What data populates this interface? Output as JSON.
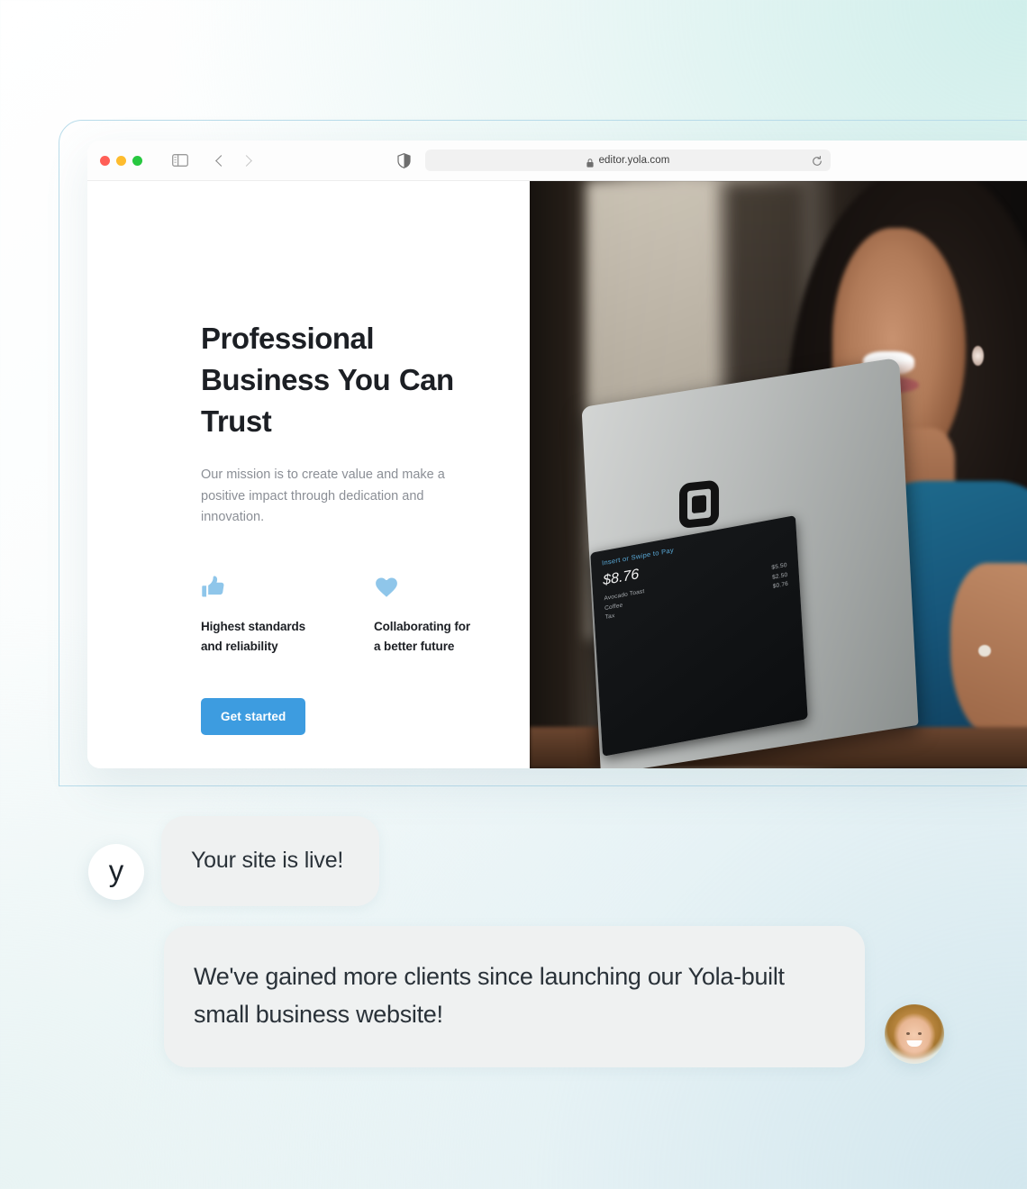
{
  "browser": {
    "url": "editor.yola.com",
    "icons": {
      "sidebar": "sidebar-toggle-icon",
      "back": "back-chevron-icon",
      "forward": "forward-chevron-icon",
      "shield": "privacy-shield-icon",
      "lock": "lock-icon",
      "reload": "reload-icon"
    }
  },
  "hero": {
    "title": "Professional Business You Can Trust",
    "subtitle": "Our mission is to create value and make a positive impact through dedication and innovation.",
    "features": [
      {
        "icon": "thumbs-up-icon",
        "label": "Highest standards and reliability"
      },
      {
        "icon": "heart-icon",
        "label": "Collaborating for a better future"
      }
    ],
    "cta_label": "Get started",
    "accent_color": "#3d9ce0",
    "icon_color": "#8fc6ea"
  },
  "hero_image": {
    "pos_terminal": {
      "prompt": "Insert or Swipe to Pay",
      "total": "$8.76",
      "items": [
        {
          "name": "Avocado Toast",
          "price": "$5.50"
        },
        {
          "name": "Coffee",
          "price": "$2.50"
        },
        {
          "name": "Tax",
          "price": "$0.76"
        }
      ]
    }
  },
  "chat": {
    "brand_mark": "y",
    "messages": [
      {
        "sender": "yola",
        "text": "Your site is live!"
      },
      {
        "sender": "client",
        "text": "We've gained more clients since launching our Yola-built small business website!"
      }
    ]
  }
}
